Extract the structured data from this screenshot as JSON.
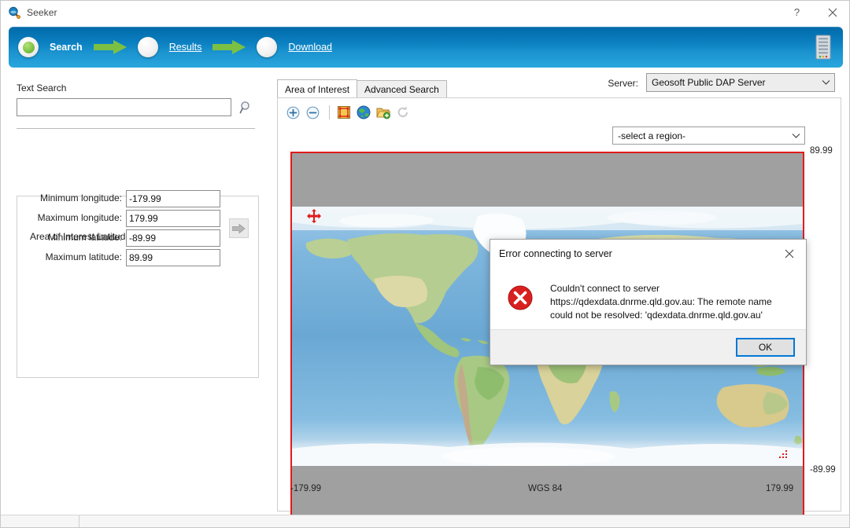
{
  "window": {
    "title": "Seeker",
    "icon": "seeker-app-icon",
    "help_label": "?",
    "close_label": "✕"
  },
  "banner": {
    "steps": [
      {
        "label": "Search",
        "state": "active",
        "icon": "green-dot-icon"
      },
      {
        "label": "Results",
        "state": "link",
        "icon": "empty-dot-icon"
      },
      {
        "label": "Download",
        "state": "link",
        "icon": "empty-dot-icon"
      }
    ],
    "server_icon": "server-tower-icon"
  },
  "left": {
    "text_search_label": "Text Search",
    "text_search_value": "",
    "text_search_placeholder": "",
    "search_icon": "magnifier-icon",
    "aoi_title": "Area of Interest Latitude and Longitude",
    "fields": [
      {
        "label": "Minimum longitude:",
        "value": "-179.99"
      },
      {
        "label": "Maximum longitude:",
        "value": "179.99"
      },
      {
        "label": "Minimum latitude:",
        "value": "-89.99"
      },
      {
        "label": "Maximum latitude:",
        "value": "89.99"
      }
    ],
    "apply_icon": "arrow-right-icon"
  },
  "right": {
    "server_label": "Server:",
    "server_value": "Geosoft Public DAP Server",
    "region_value": "-select a region-",
    "chevron_icon": "chevron-down-icon",
    "tabs": [
      {
        "label": "Area of Interest",
        "active": true
      },
      {
        "label": "Advanced Search",
        "active": false
      }
    ],
    "toolbar": [
      {
        "icon": "zoom-in-icon",
        "name": "zoom-in"
      },
      {
        "icon": "zoom-out-icon",
        "name": "zoom-out"
      },
      {
        "icon": "select-extent-icon",
        "name": "select-extent"
      },
      {
        "icon": "globe-icon",
        "name": "full-extent"
      },
      {
        "icon": "open-folder-add-icon",
        "name": "load-area"
      },
      {
        "icon": "refresh-icon",
        "name": "refresh"
      }
    ],
    "map": {
      "lat_max": "89.99",
      "lat_min": "-89.99",
      "lon_min": "-179.99",
      "lon_max": "179.99",
      "datum": "WGS 84",
      "handle_icon": "move-handle-icon",
      "resize_icon": "resize-handle-icon"
    }
  },
  "dialog": {
    "title": "Error connecting to server",
    "close_label": "✕",
    "icon": "error-circle-icon",
    "message": "Couldn't connect to server https://qdexdata.dnrme.qld.gov.au: The remote name could not be resolved: 'qdexdata.dnrme.qld.gov.au'",
    "ok_label": "OK"
  },
  "colors": {
    "banner_start": "#0069a8",
    "banner_end": "#2aa6de",
    "arrow_green": "#7cc043",
    "selection_red": "#e01b1b",
    "error_red": "#d92020",
    "focus_blue": "#0078d7",
    "map_bg": "#a0a0a0"
  }
}
